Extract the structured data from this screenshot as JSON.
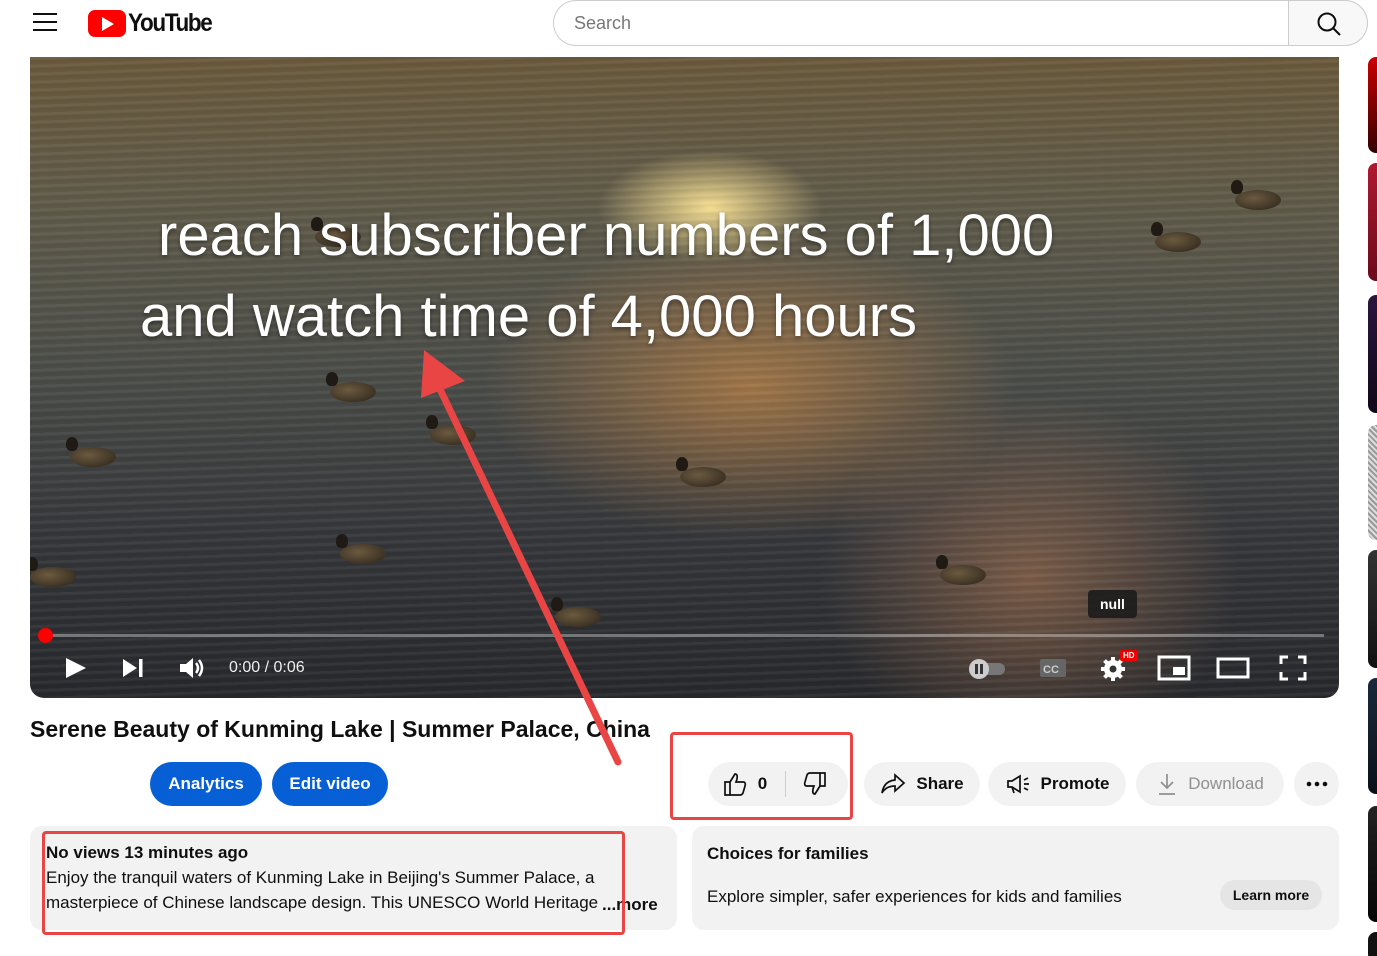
{
  "header": {
    "logo_text": "YouTube",
    "search_placeholder": "Search"
  },
  "player": {
    "caption_line_1": "reach subscriber numbers of 1,000",
    "caption_line_2": "and watch time of 4,000 hours",
    "tooltip": "null",
    "time": "0:00 / 0:06",
    "hd_badge": "HD",
    "progress_fraction": 0
  },
  "video": {
    "title": "Serene Beauty of Kunming Lake | Summer Palace, China",
    "analytics_label": "Analytics",
    "edit_label": "Edit video",
    "like_count": "0",
    "share_label": "Share",
    "promote_label": "Promote",
    "download_label": "Download"
  },
  "description": {
    "meta": "No views  13 minutes ago",
    "text": "Enjoy the tranquil waters of Kunming Lake in Beijing's Summer Palace, a masterpiece of Chinese landscape design. This UNESCO World Heritage",
    "more": "...more"
  },
  "families": {
    "title": "Choices for families",
    "text": "Explore simpler, safer experiences for kids and families",
    "learn_more": "Learn more"
  },
  "colors": {
    "brand_red": "#ff0000",
    "button_blue": "#065fd4",
    "annotation_red": "#e94545"
  }
}
